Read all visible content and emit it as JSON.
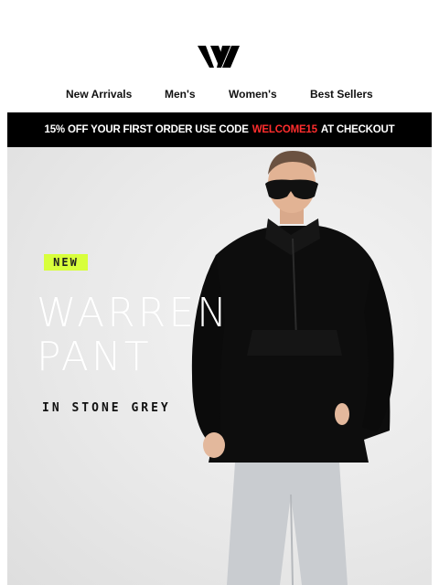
{
  "brand": {
    "logo_icon": "wv-logo-icon"
  },
  "nav": {
    "items": [
      {
        "label": "New Arrivals"
      },
      {
        "label": "Men's"
      },
      {
        "label": "Women's"
      },
      {
        "label": "Best Sellers"
      }
    ]
  },
  "promo": {
    "prefix": "15% OFF YOUR FIRST ORDER USE CODE",
    "code": "WELCOME15",
    "suffix": "AT CHECKOUT",
    "code_color": "#ff2d2d"
  },
  "hero": {
    "badge": "NEW",
    "badge_color": "#d8ff3c",
    "headline_line1": "WARREN",
    "headline_line2": "PANT",
    "subtitle": "IN STONE GREY"
  }
}
